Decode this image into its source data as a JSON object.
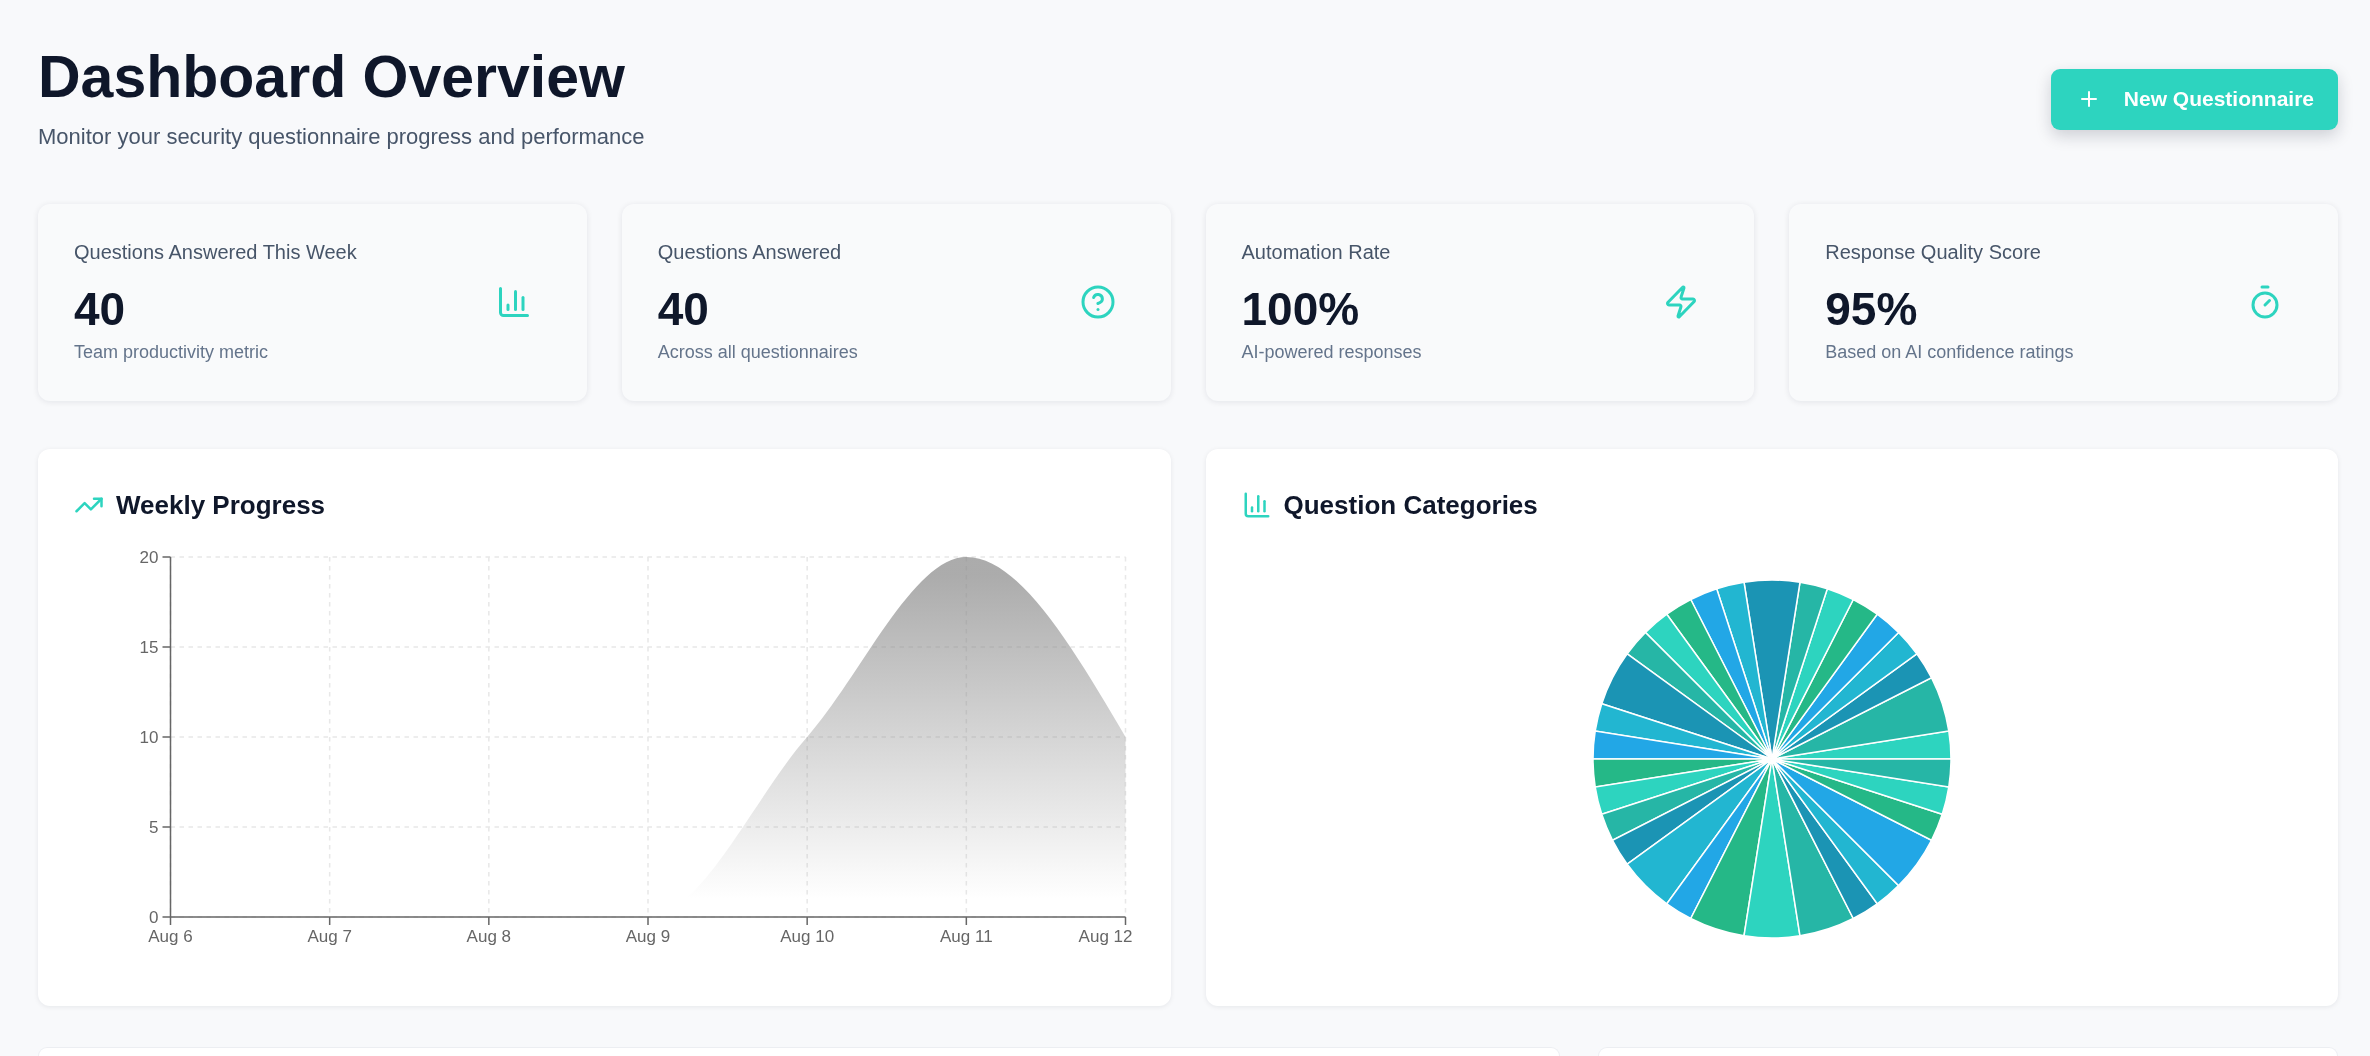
{
  "header": {
    "title": "Dashboard Overview",
    "subtitle": "Monitor your security questionnaire progress and performance",
    "new_button": {
      "label": "New Questionnaire"
    }
  },
  "stat_cards": [
    {
      "label": "Questions Answered This Week",
      "value": "40",
      "caption": "Team productivity metric"
    },
    {
      "label": "Questions Answered",
      "value": "40",
      "caption": "Across all questionnaires"
    },
    {
      "label": "Automation Rate",
      "value": "100%",
      "caption": "AI-powered responses"
    },
    {
      "label": "Response Quality Score",
      "value": "95%",
      "caption": "Based on AI confidence ratings"
    }
  ],
  "chart_panels": [
    {
      "kind": "area",
      "title": "Weekly Progress",
      "chart_data": {
        "type": "area",
        "categories": [
          "Aug 6",
          "Aug 7",
          "Aug 8",
          "Aug 9",
          "Aug 10",
          "Aug 11",
          "Aug 12"
        ],
        "series": [
          {
            "color": "#888888",
            "values": [
              0,
              0,
              0,
              0,
              10,
              20,
              10
            ]
          }
        ],
        "ylim": [
          0,
          20
        ],
        "yticks": [
          0,
          5,
          10,
          15,
          20
        ],
        "grid": true
      }
    },
    {
      "kind": "pie",
      "title": "Question Categories"
    }
  ]
}
